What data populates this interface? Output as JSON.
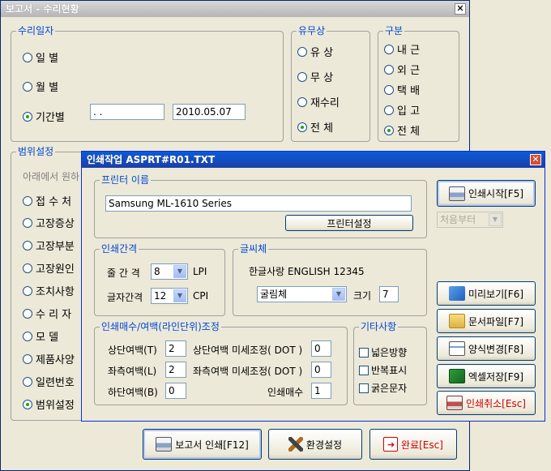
{
  "main": {
    "title": "보고서 - 수리현황",
    "close": "✕",
    "repair_date": {
      "title": "수리일자",
      "options": [
        "일   별",
        "월   별",
        "기간별"
      ],
      "date_from": "  .   .",
      "date_to": "2010.05.07"
    },
    "presence": {
      "title": "유무상",
      "options": [
        "유   상",
        "무   상",
        "재수리",
        "전   체"
      ]
    },
    "category": {
      "title": "구분",
      "options": [
        "내 근",
        "외 근",
        "택 배",
        "입 고",
        "전 체"
      ]
    },
    "range": {
      "title": "범위설정",
      "hint": "아래에서 원하",
      "options": [
        "접 수 처",
        "고장증상",
        "고장부분",
        "고장원인",
        "조치사항",
        "수 리 자",
        "모   델",
        "제품사양",
        "일련번호",
        "범위설정"
      ]
    },
    "buttons": {
      "print_report": "보고서 인쇄[F12]",
      "settings": "환경설정",
      "done": "완료[Esc]"
    }
  },
  "print": {
    "title": "인쇄작업 ASPRT#R01.TXT",
    "close": "✕",
    "printer": {
      "title": "프린터 이름",
      "name": "Samsung ML-1610 Series",
      "setup": "프린터설정"
    },
    "spacing": {
      "title": "인쇄간격",
      "line_label": "줄 간 격",
      "line_value": "8",
      "line_unit": "LPI",
      "char_label": "글자간격",
      "char_value": "12",
      "char_unit": "CPI"
    },
    "font": {
      "title": "글씨체",
      "sample": "한글사랑 ENGLISH 12345",
      "face": "굴림체",
      "size_label": "크기",
      "size_value": "7"
    },
    "margins": {
      "title": "인쇄매수/여백(라인단위)조정",
      "top_label": "상단여백(T)",
      "top_value": "2",
      "top_fine_label": "상단여백 미세조정( DOT )",
      "top_fine_value": "0",
      "left_label": "좌측여백(L)",
      "left_value": "2",
      "left_fine_label": "좌측여백 미세조정( DOT )",
      "left_fine_value": "0",
      "bottom_label": "하단여백(B)",
      "bottom_value": "0",
      "copies_label": "인쇄매수",
      "copies_value": "1"
    },
    "misc": {
      "title": "기타사항",
      "options": [
        "넓은방향",
        "반복표시",
        "굵은문자"
      ]
    },
    "side": {
      "start": "인쇄시작[F5]",
      "from": "처음부터",
      "preview": "미리보기[F6]",
      "file": "문서파일[F7]",
      "format": "양식변경[F8]",
      "excel": "엑셀저장[F9]",
      "cancel": "인쇄취소[Esc]"
    }
  }
}
